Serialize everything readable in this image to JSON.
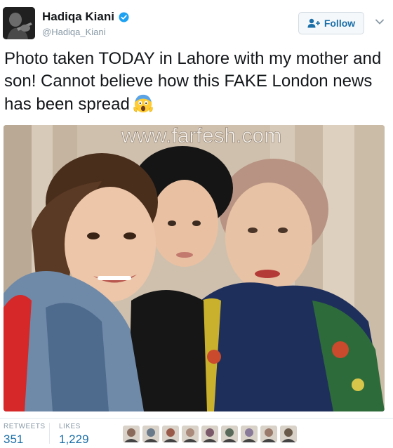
{
  "user": {
    "display_name": "Hadiqa Kiani",
    "handle": "@Hadiqa_Kiani",
    "verified": true
  },
  "follow_button": {
    "label": "Follow",
    "icon": "add-user-icon"
  },
  "menu_icon": "chevron-down-icon",
  "tweet": {
    "text": "Photo taken TODAY in Lahore with my mother and son! Cannot believe how this FAKE London news has been spread",
    "emoji": "face-screaming-in-fear"
  },
  "photo": {
    "watermark": "www.farfesh.com"
  },
  "stats": {
    "retweets_label": "RETWEETS",
    "retweets": "351",
    "likes_label": "LIKES",
    "likes": "1,229"
  },
  "liker_avatars_count": 9,
  "colors": {
    "link_blue": "#1b6fa8",
    "verified_blue": "#1da1f2",
    "text": "#14171a",
    "muted": "#8899a6"
  }
}
